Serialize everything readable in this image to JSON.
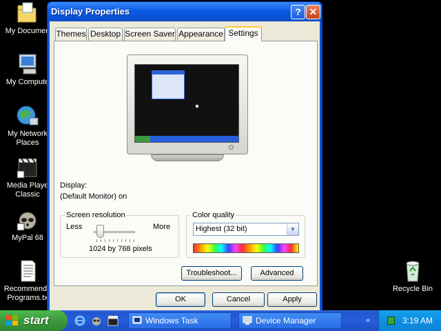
{
  "desktop": {
    "icons": [
      {
        "label": "My Documen"
      },
      {
        "label": "My Compute"
      },
      {
        "label": "My Network\nPlaces"
      },
      {
        "label": "Media Playe\nClassic"
      },
      {
        "label": "MyPal 68"
      },
      {
        "label": "Recommende\nPrograms.tx"
      },
      {
        "label": "Recycle Bin"
      }
    ]
  },
  "window": {
    "title": "Display Properties",
    "help_label": "?",
    "close_label": "✕",
    "tabs": [
      {
        "label": "Themes"
      },
      {
        "label": "Desktop"
      },
      {
        "label": "Screen Saver"
      },
      {
        "label": "Appearance"
      },
      {
        "label": "Settings"
      }
    ],
    "display_label": "Display:",
    "display_value": "(Default Monitor) on",
    "screen_resolution": {
      "title": "Screen resolution",
      "less": "Less",
      "more": "More",
      "value": "1024 by 768 pixels",
      "slider_fraction": 0.2
    },
    "color_quality": {
      "title": "Color quality",
      "selected": "Highest (32 bit)"
    },
    "buttons": {
      "troubleshoot": "Troubleshoot...",
      "advanced": "Advanced",
      "ok": "OK",
      "cancel": "Cancel",
      "apply": "Apply"
    }
  },
  "taskbar": {
    "start_label": "start",
    "tasks": [
      {
        "label": "Windows Task Manager"
      },
      {
        "label": "Device Manager"
      }
    ],
    "clock": "3:19 AM",
    "expand_label": "«"
  },
  "colors": {
    "window_blue": "#0a55e0",
    "dialog_face": "#ece9d8",
    "start_green": "#3c9a3c",
    "taskbar_blue": "#245edb",
    "tray_blue": "#0f8ee0"
  }
}
